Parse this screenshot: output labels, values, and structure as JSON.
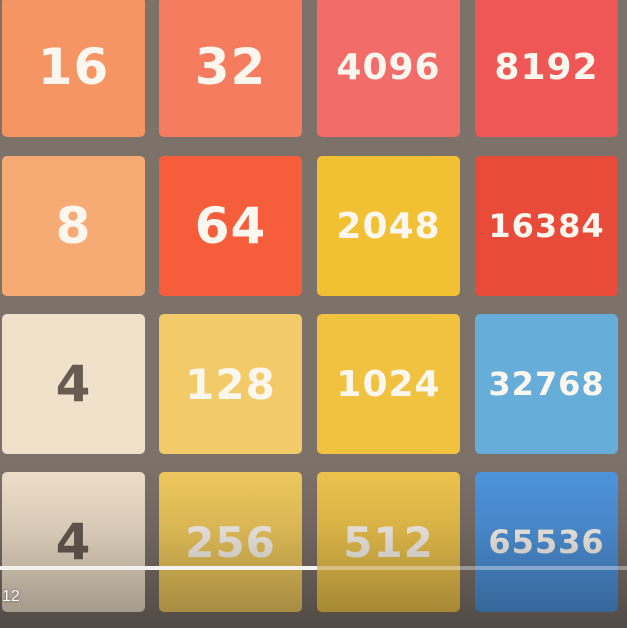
{
  "board": {
    "rows": 4,
    "cols": 4,
    "tiles": [
      [
        {
          "value": "16",
          "bg": "#f59563",
          "fg": "#fbf6ee"
        },
        {
          "value": "32",
          "bg": "#f67c5f",
          "fg": "#fbf6ee"
        },
        {
          "value": "4096",
          "bg": "#f26d6a",
          "fg": "#fbf6ee"
        },
        {
          "value": "8192",
          "bg": "#ef5656",
          "fg": "#fbf6ee"
        }
      ],
      [
        {
          "value": "8",
          "bg": "#f6ab75",
          "fg": "#fbf6ee"
        },
        {
          "value": "64",
          "bg": "#f65e3b",
          "fg": "#fbf6ee"
        },
        {
          "value": "2048",
          "bg": "#f2c033",
          "fg": "#fbf6ee"
        },
        {
          "value": "16384",
          "bg": "#e84b3a",
          "fg": "#fbf6ee"
        }
      ],
      [
        {
          "value": "4",
          "bg": "#f0e1cb",
          "fg": "#675c52"
        },
        {
          "value": "128",
          "bg": "#f2ca68",
          "fg": "#fbf6ee"
        },
        {
          "value": "1024",
          "bg": "#f1c140",
          "fg": "#fbf6ee"
        },
        {
          "value": "32768",
          "bg": "#67add9",
          "fg": "#fbf6ee"
        }
      ],
      [
        {
          "value": "4",
          "bg": "#f0e1cb",
          "fg": "#675c52"
        },
        {
          "value": "256",
          "bg": "#f2cb5e",
          "fg": "#fbf6ee"
        },
        {
          "value": "512",
          "bg": "#f1c64e",
          "fg": "#fbf6ee"
        },
        {
          "value": "65536",
          "bg": "#4f95de",
          "fg": "#fbf6ee"
        }
      ]
    ]
  },
  "player": {
    "time": "12",
    "progress": 0.505
  },
  "colors": {
    "board_gap": "#7d726a"
  }
}
